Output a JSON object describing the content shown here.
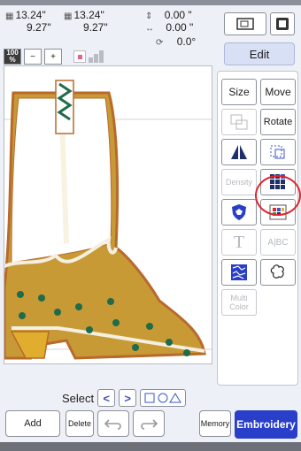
{
  "info": {
    "width_total": "13.24\"",
    "height_total": "9.27\"",
    "width_pattern": "13.24\"",
    "height_pattern": "9.27\"",
    "vertical_offset": "0.00 \"",
    "horizontal_offset": "0.00 \"",
    "rotation_angle": "0.0°"
  },
  "zoom": {
    "level_badge": "100 %",
    "zoom_out": "−",
    "zoom_in": "+"
  },
  "header": {
    "edit_label": "Edit"
  },
  "panel": {
    "size": "Size",
    "move": "Move",
    "rotate": "Rotate",
    "density": "Density",
    "text_tool": "T",
    "abc_tool": "A|BC",
    "multi_color": "Multi\nColor"
  },
  "bottom": {
    "select_label": "Select",
    "prev": "<",
    "next": ">",
    "add": "Add",
    "delete": "Delete",
    "memory": "Memory",
    "embroidery": "Embroidery"
  },
  "icons": [
    "hoop-dimension-icon",
    "updown-arrows-icon",
    "leftright-arrows-icon",
    "rotate-icon",
    "sewing-machine-icon",
    "mirror-icon",
    "pattern-area-icon",
    "color-blocks-icon",
    "color-sort-icon",
    "applique-shield-icon",
    "stitch-fill-icon",
    "outline-icon",
    "undo-icon",
    "redo-icon"
  ],
  "colors": {
    "accent": "#2a3fc9",
    "edit_bg": "#d8e0f5",
    "boot_gold": "#c79a35",
    "boot_stitch": "#b86a2d",
    "highlight": "#e0242c"
  }
}
